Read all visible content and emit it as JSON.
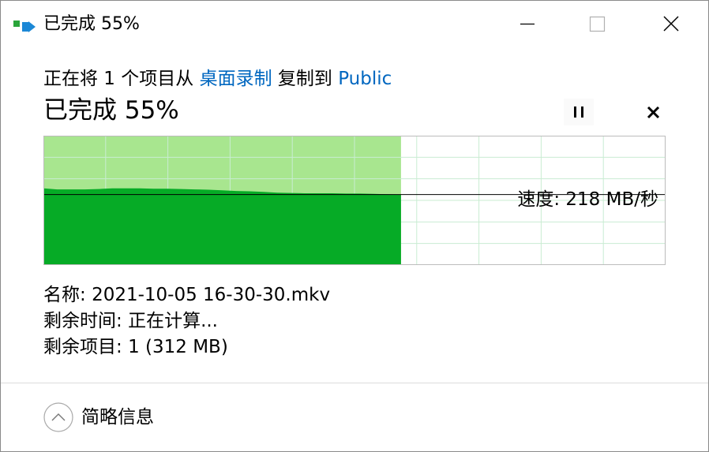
{
  "window": {
    "title": "已完成 55%",
    "icon": "copy-transfer-icon",
    "controls": [
      "minimize-icon",
      "maximize-icon",
      "close-icon"
    ]
  },
  "copy": {
    "prefix": "正在将 1 个项目从 ",
    "source": "桌面录制",
    "middle": " 复制到 ",
    "destination": "Public"
  },
  "status": {
    "title": "已完成 55%",
    "pause_icon": "pause-icon",
    "cancel_icon": "cancel-icon"
  },
  "speed": {
    "label": "速度: 218 MB/秒"
  },
  "details": {
    "name_label": "名称:",
    "name_value": "2021-10-05 16-30-30.mkv",
    "time_label": "剩余时间:",
    "time_value": "正在计算...",
    "items_label": "剩余项目:",
    "items_value": "1 (312 MB)"
  },
  "footer": {
    "toggle_icon": "chevron-up-icon",
    "label": "简略信息"
  },
  "colors": {
    "accent": "#0067c0",
    "progress_fill": "#a8e68f",
    "speed_fill": "#06ab26",
    "grid": "#c9ecd2",
    "chart_border": "#bcbcbc"
  },
  "chart_data": {
    "type": "area",
    "progress": 0.55,
    "current_speed": 218,
    "unit": "MB/秒",
    "speed_samples": [
      237,
      234,
      234,
      234,
      235,
      237,
      237,
      237,
      236,
      236,
      235,
      234,
      233,
      231,
      229,
      228,
      226,
      224,
      223,
      222,
      222,
      222,
      221,
      221,
      220,
      219,
      218
    ]
  }
}
